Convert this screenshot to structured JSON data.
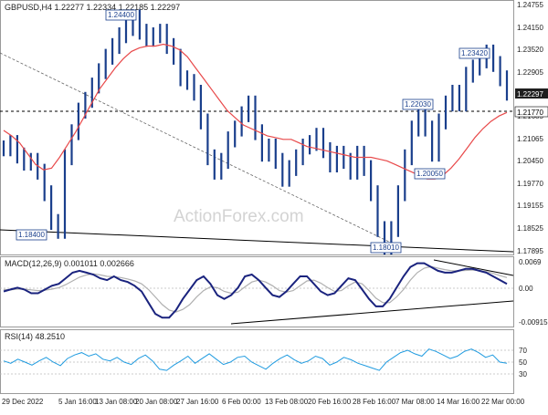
{
  "colors": {
    "background": "#ffffff",
    "price_bars": "#1a3f8c",
    "moving_average": "#e8494a",
    "macd_line": "#1a237e",
    "signal_line": "#b0b0b0",
    "rsi_line": "#1f9be0",
    "trendline": "#000000",
    "dotted_trendline": "#666666",
    "grid": "#d8d8d8",
    "text": "#222222",
    "watermark": "#d3d3d3"
  },
  "price_pane": {
    "header": "GBPUSD,H4  1.22277 1.22334 1.22185 1.22297",
    "watermark": "ActionForex.com",
    "y_ticks": [
      "1.24755",
      "1.24150",
      "1.23520",
      "1.22905",
      "1.22297",
      "1.21685",
      "1.21065",
      "1.20450",
      "1.19770",
      "1.19155",
      "1.18525",
      "1.17895"
    ],
    "current_price_label": "1.22297",
    "hline_label": "1.21770",
    "annotations": [
      "1.24400",
      "1.23420",
      "1.22030",
      "1.20050",
      "1.18400",
      "1.18010"
    ]
  },
  "macd_pane": {
    "header": "MACD(12,26,9) 0.001011 0.002666",
    "y_ticks": [
      "0.0069",
      "0.00",
      "-0.009158"
    ]
  },
  "rsi_pane": {
    "header": "RSI(14) 48.2510",
    "y_ticks": [
      "70",
      "50",
      "30"
    ]
  },
  "x_axis": {
    "ticks": [
      "29 Dec 2022",
      "5 Jan 16:00",
      "13 Jan 08:00",
      "20 Jan 08:00",
      "27 Jan 16:00",
      "6 Feb 00:00",
      "13 Feb 08:00",
      "20 Feb 16:00",
      "28 Feb 16:00",
      "7 Mar 08:00",
      "14 Mar 16:00",
      "22 Mar 00:00"
    ]
  },
  "chart_data": [
    {
      "type": "line",
      "series": [
        {
          "values": [
            1.2075,
            1.209,
            1.2055,
            1.2035,
            1.204,
            1.201,
            1.195,
            1.187,
            1.1845,
            1.205,
            1.212,
            1.218,
            1.221,
            1.225,
            1.229,
            1.233,
            1.236,
            1.239,
            1.241,
            1.244,
            1.24,
            1.238,
            1.239,
            1.24,
            1.236,
            1.233,
            1.227,
            1.226,
            1.223,
            1.215,
            1.205,
            1.201,
            1.204,
            1.21,
            1.213,
            1.217,
            1.22,
            1.212,
            1.206,
            1.208,
            1.204,
            1.199,
            1.202,
            1.205,
            1.208,
            1.209,
            1.211,
            1.207,
            1.203,
            1.206,
            1.204,
            1.201,
            1.206,
            1.202,
            1.195,
            1.185,
            1.1801,
            1.185,
            1.195,
            1.205,
            1.213,
            1.218,
            1.213,
            1.206,
            1.215,
            1.22,
            1.223,
            1.22,
            1.228,
            1.23,
            1.232,
            1.2342,
            1.231,
            1.227,
            1.223
          ]
        },
        {
          "type": "moving_average",
          "values": [
            1.2125,
            1.211,
            1.209,
            1.206,
            1.203,
            1.2015,
            1.202,
            1.205,
            1.2085,
            1.212,
            1.216,
            1.22,
            1.224,
            1.227,
            1.23,
            1.2325,
            1.2345,
            1.2355,
            1.236,
            1.236,
            1.2365,
            1.236,
            1.235,
            1.233,
            1.23,
            1.227,
            1.224,
            1.221,
            1.218,
            1.216,
            1.214,
            1.213,
            1.212,
            1.211,
            1.2105,
            1.21,
            1.21,
            1.209,
            1.208,
            1.2075,
            1.207,
            1.2065,
            1.206,
            1.2055,
            1.205,
            1.205,
            1.205,
            1.2045,
            1.204,
            1.203,
            1.202,
            1.201,
            1.2,
            1.199,
            1.199,
            1.2,
            1.202,
            1.2045,
            1.2075,
            1.2105,
            1.213,
            1.215,
            1.2165,
            1.2175
          ]
        }
      ]
    },
    {
      "type": "line",
      "series": [
        {
          "values": [
            -0.001,
            -0.0005,
            0.0,
            -0.0005,
            -0.0015,
            -0.0015,
            -0.0005,
            0.0005,
            0.001,
            0.0025,
            0.004,
            0.0045,
            0.004,
            0.0035,
            0.0025,
            0.002,
            0.003,
            0.002,
            0.0015,
            0.0005,
            -0.001,
            -0.004,
            -0.007,
            -0.008,
            -0.008,
            -0.006,
            -0.003,
            -0.0005,
            0.002,
            0.003,
            0.001,
            -0.002,
            -0.003,
            -0.002,
            0.0,
            0.003,
            0.0035,
            0.002,
            0.0,
            -0.002,
            -0.0025,
            -0.001,
            0.001,
            0.003,
            0.003,
            0.001,
            -0.001,
            -0.002,
            -0.0015,
            0.0005,
            0.0025,
            0.002,
            -0.0005,
            -0.003,
            -0.005,
            -0.005,
            -0.003,
            0.0,
            0.003,
            0.0055,
            0.0065,
            0.0065,
            0.0055,
            0.0045,
            0.004,
            0.004,
            0.0045,
            0.005,
            0.005,
            0.0045,
            0.004,
            0.003,
            0.002,
            0.001
          ]
        },
        {
          "values": [
            -0.0005,
            -0.0006,
            -0.0004,
            -0.0004,
            -0.0006,
            -0.0008,
            -0.0007,
            -0.0004,
            0.0,
            0.0008,
            0.0018,
            0.0028,
            0.0034,
            0.0037,
            0.0034,
            0.003,
            0.0029,
            0.0027,
            0.0023,
            0.0018,
            0.001,
            -0.0005,
            -0.0025,
            -0.0045,
            -0.006,
            -0.0065,
            -0.0058,
            -0.0045,
            -0.0025,
            -0.0008,
            0.0002,
            0.0,
            -0.001,
            -0.0015,
            -0.0012,
            0.0002,
            0.0015,
            0.002,
            0.0015,
            0.0005,
            -0.0008,
            -0.0012,
            -0.0008,
            0.0005,
            0.0018,
            0.002,
            0.0012,
            0.0,
            -0.001,
            -0.0008,
            0.0005,
            0.0015,
            0.001,
            -0.0008,
            -0.0028,
            -0.004,
            -0.004,
            -0.0025,
            -0.0005,
            0.002,
            0.004,
            0.0052,
            0.0056,
            0.0052,
            0.0048,
            0.0045,
            0.0045,
            0.0046,
            0.0047,
            0.0046,
            0.0043,
            0.0038,
            0.0032,
            0.0027
          ]
        }
      ]
    },
    {
      "type": "line",
      "series": [
        {
          "values": [
            52,
            48,
            55,
            50,
            45,
            52,
            58,
            50,
            44,
            56,
            62,
            66,
            60,
            64,
            55,
            52,
            58,
            50,
            46,
            56,
            62,
            52,
            38,
            36,
            45,
            52,
            60,
            48,
            56,
            64,
            55,
            46,
            50,
            58,
            60,
            50,
            44,
            38,
            48,
            56,
            62,
            54,
            48,
            52,
            60,
            56,
            45,
            50,
            58,
            54,
            48,
            44,
            40,
            36,
            50,
            58,
            66,
            70,
            64,
            60,
            72,
            68,
            62,
            56,
            60,
            68,
            72,
            66,
            58,
            62,
            50,
            48
          ]
        }
      ]
    }
  ]
}
